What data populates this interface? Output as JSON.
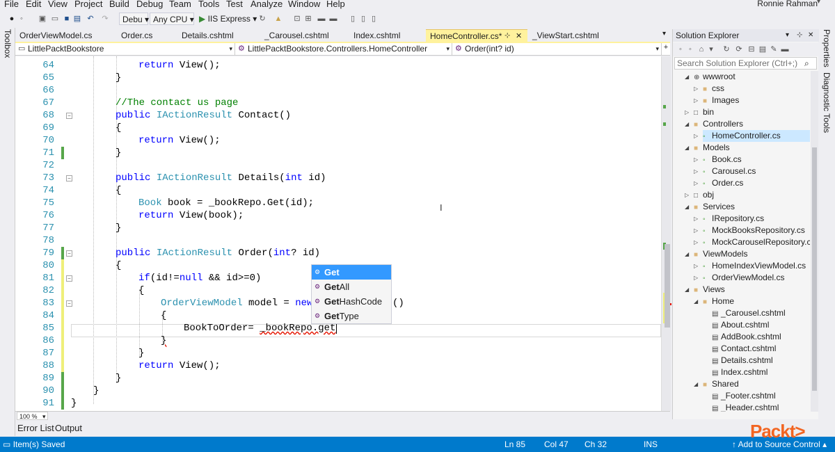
{
  "menu": [
    "File",
    "Edit",
    "View",
    "Project",
    "Build",
    "Debug",
    "Team",
    "Tools",
    "Test",
    "Analyze",
    "Window",
    "Help"
  ],
  "user": "Ronnie Rahman",
  "toolbar": {
    "config": "Debu",
    "platform": "Any CPU",
    "run_target": "IIS Express"
  },
  "side_left": "Toolbox",
  "side_right": [
    "Properties",
    "Diagnostic Tools"
  ],
  "tabs": [
    "OrderViewModel.cs",
    "Order.cs",
    "Details.cshtml",
    "_Carousel.cshtml",
    "Index.cshtml",
    "HomeController.cs*",
    "_ViewStart.cshtml"
  ],
  "nav": {
    "project": "LittlePacktBookstore",
    "class": "LittlePacktBookstore.Controllers.HomeController",
    "member": "Order(int? id)"
  },
  "editor": {
    "line_numbers": [
      "64",
      "65",
      "66",
      "67",
      "68",
      "69",
      "70",
      "71",
      "72",
      "73",
      "74",
      "75",
      "76",
      "77",
      "78",
      "79",
      "80",
      "81",
      "82",
      "83",
      "84",
      "85",
      "86",
      "87",
      "88",
      "89",
      "90",
      "91"
    ],
    "lines": {
      "l64_kw": "return",
      "l64_rest": " View();",
      "l65": "}",
      "l67": "//The contact us page",
      "l68_kw": "public",
      "l68_ty": "IActionResult",
      "l68_rest": " Contact()",
      "l69": "{",
      "l70_kw": "return",
      "l70_rest": " View();",
      "l71": "}",
      "l73_kw": "public",
      "l73_ty": "IActionResult",
      "l73_rest": " Details(",
      "l73_kw2": "int",
      "l73_end": " id)",
      "l74": "{",
      "l75_ty": "Book",
      "l75_rest": " book = _bookRepo.Get(id);",
      "l76_kw": "return",
      "l76_rest": " View(book);",
      "l77": "}",
      "l79_kw": "public",
      "l79_ty": "IActionResult",
      "l79_rest": " Order(",
      "l79_kw2": "int",
      "l79_end": "? id)",
      "l80": "{",
      "l81_kw": "if",
      "l81_a": "(id!=",
      "l81_kw2": "null",
      "l81_b": " && id>=0)",
      "l82": "{",
      "l83_ty": "OrderViewModel",
      "l83_rest": " model = ",
      "l83_kw": "new",
      "l83_end": "()",
      "l84": "{",
      "l85_a": "BookToOrder= ",
      "l85_b": "_bookRepo.get",
      "l86": "}",
      "l87": "}",
      "l88_kw": "return",
      "l88_rest": " View();",
      "l89": "}",
      "l90": "}",
      "l91": "}"
    }
  },
  "intellisense": [
    {
      "bold": "Get",
      "rest": ""
    },
    {
      "bold": "Get",
      "rest": "All"
    },
    {
      "bold": "Get",
      "rest": "HashCode"
    },
    {
      "bold": "Get",
      "rest": "Type"
    }
  ],
  "zoom": "100 %",
  "bottom_tabs": [
    "Error List",
    "Output"
  ],
  "status": {
    "message": "Item(s) Saved",
    "ln": "Ln 85",
    "col": "Col 47",
    "ch": "Ch 32",
    "mode": "INS",
    "source_control": "Add to Source Control"
  },
  "solution_explorer": {
    "title": "Solution Explorer",
    "search_placeholder": "Search Solution Explorer (Ctrl+;)",
    "items": [
      "wwwroot",
      "css",
      "Images",
      "bin",
      "Controllers",
      "HomeController.cs",
      "Models",
      "Book.cs",
      "Carousel.cs",
      "Order.cs",
      "obj",
      "Services",
      "IRepository.cs",
      "MockBooksRepository.cs",
      "MockCarouselRepository.cs",
      "ViewModels",
      "HomeIndexViewModel.cs",
      "OrderViewModel.cs",
      "Views",
      "Home",
      "_Carousel.cshtml",
      "About.cshtml",
      "AddBook.cshtml",
      "Contact.cshtml",
      "Details.cshtml",
      "Index.cshtml",
      "Shared",
      "_Footer.cshtml",
      "_Header.cshtml"
    ]
  },
  "logo": "Packt>"
}
